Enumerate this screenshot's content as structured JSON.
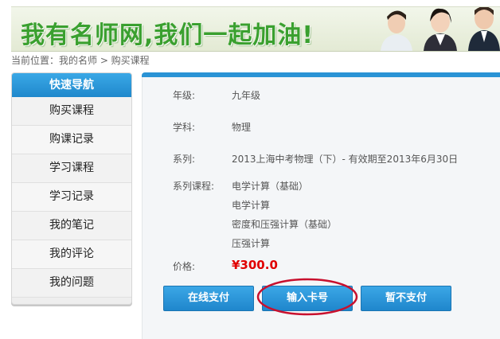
{
  "banner": {
    "title": "我有名师网,我们一起加油!"
  },
  "breadcrumb": {
    "text": "当前位置：我的名师 > 购买课程"
  },
  "sidebar": {
    "header": "快速导航",
    "items": [
      {
        "label": "购买课程"
      },
      {
        "label": "购课记录"
      },
      {
        "label": "学习课程"
      },
      {
        "label": "学习记录"
      },
      {
        "label": "我的笔记"
      },
      {
        "label": "我的评论"
      },
      {
        "label": "我的问题"
      }
    ]
  },
  "order": {
    "grade_label": "年级:",
    "grade": "九年级",
    "subject_label": "学科:",
    "subject": "物理",
    "series_label": "系列:",
    "series": "2013上海中考物理（下）- 有效期至2013年6月30日",
    "courses_label": "系列课程:",
    "courses": [
      "电学计算（基础）",
      "电学计算",
      "密度和压强计算（基础）",
      "压强计算"
    ],
    "price_label": "价格:",
    "price": "¥300.0"
  },
  "buttons": {
    "pay_online": "在线支付",
    "enter_card": "输入卡号",
    "pay_later": "暂不支付"
  },
  "colors": {
    "accent": "#2a93d5",
    "price": "#e00000",
    "annotation": "#c8102e"
  }
}
